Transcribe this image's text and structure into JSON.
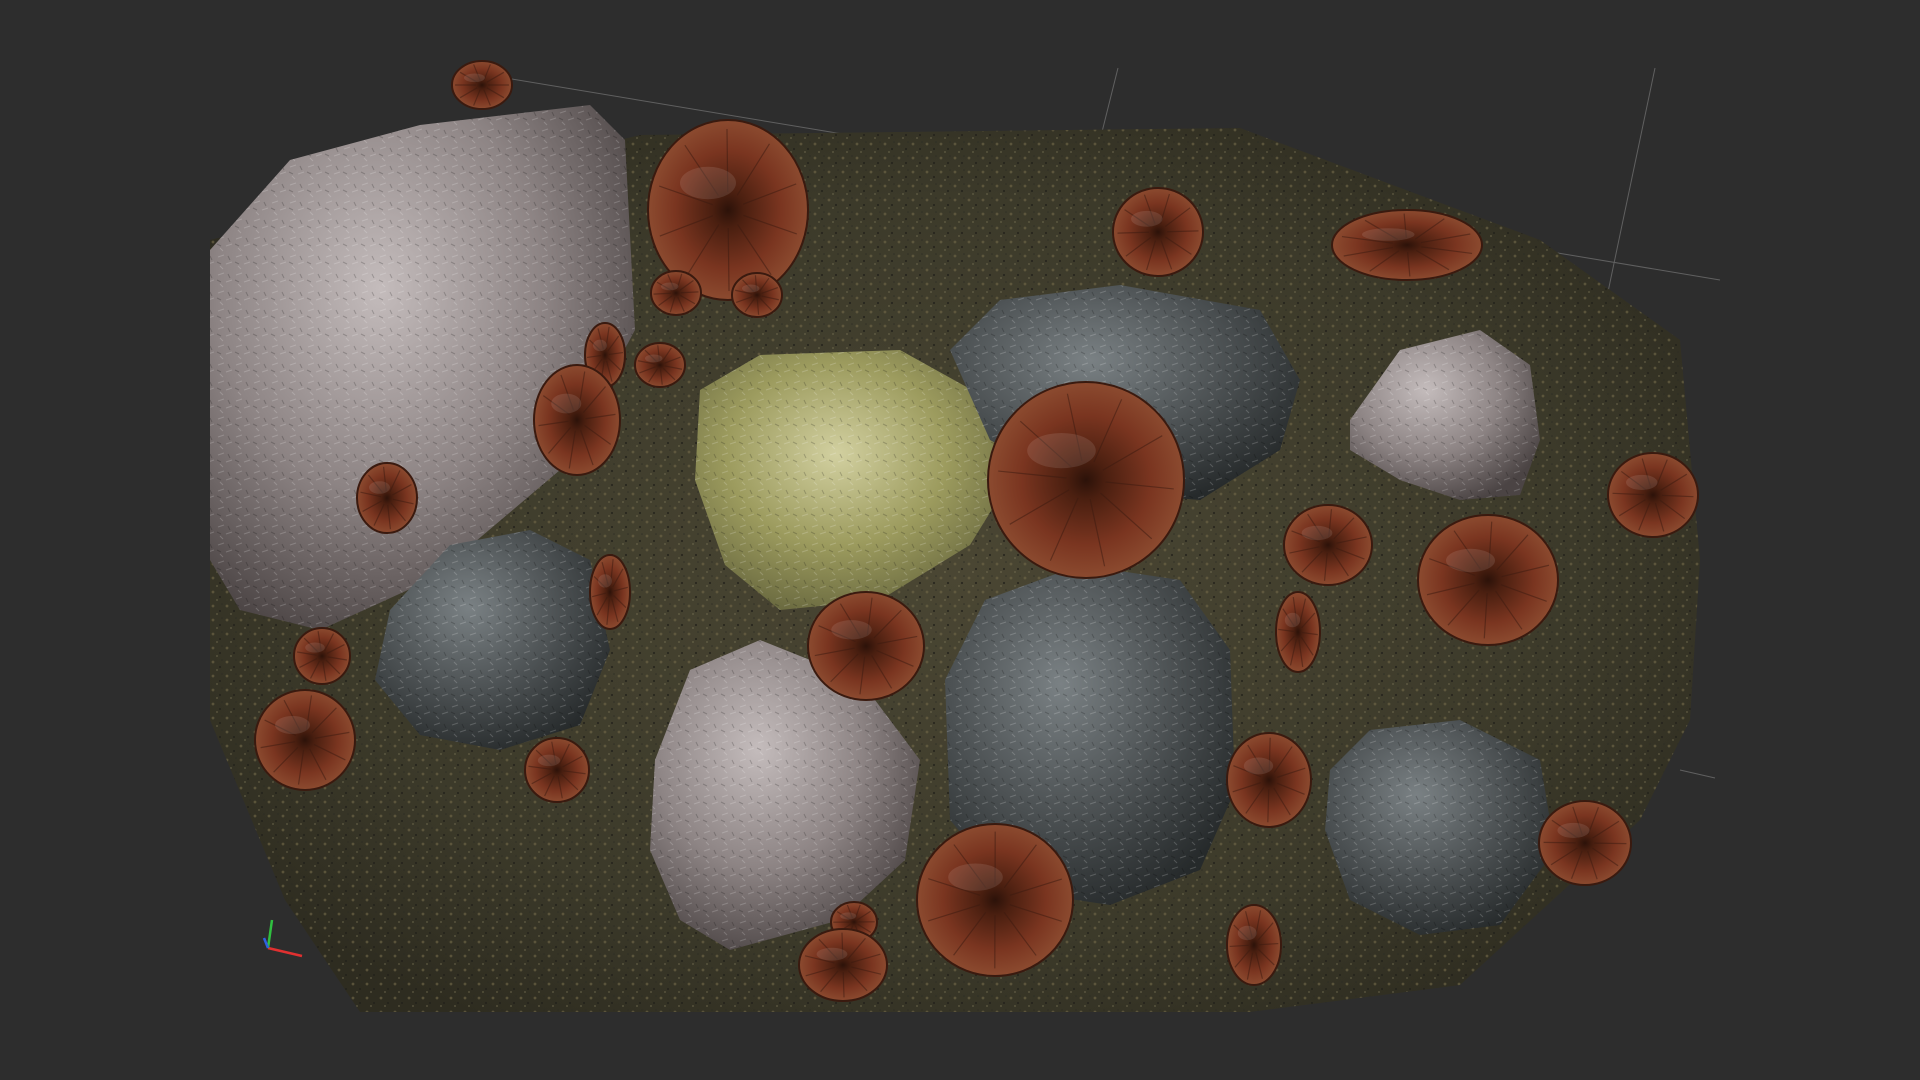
{
  "viewport": {
    "background": "#2d2d2d",
    "grid_color": "#8a8a8a",
    "grid_visible": true
  },
  "scene": {
    "ground_colors": [
      "#3f3d2c",
      "#5a5338",
      "#2b2a20",
      "#6b6345"
    ],
    "rock_colors": {
      "grey_pink": "#8d8484",
      "slate": "#4c5153",
      "mossy": "#8c8d55"
    },
    "mushroom_colors": {
      "cap": "#6e2f1c",
      "cap_dark": "#3a1a0f",
      "cap_light": "#8b4a2f"
    }
  },
  "gizmo": {
    "icon": "axis-gizmo-icon",
    "x_color": "#e03030",
    "y_color": "#30c040",
    "z_color": "#3060e0"
  }
}
